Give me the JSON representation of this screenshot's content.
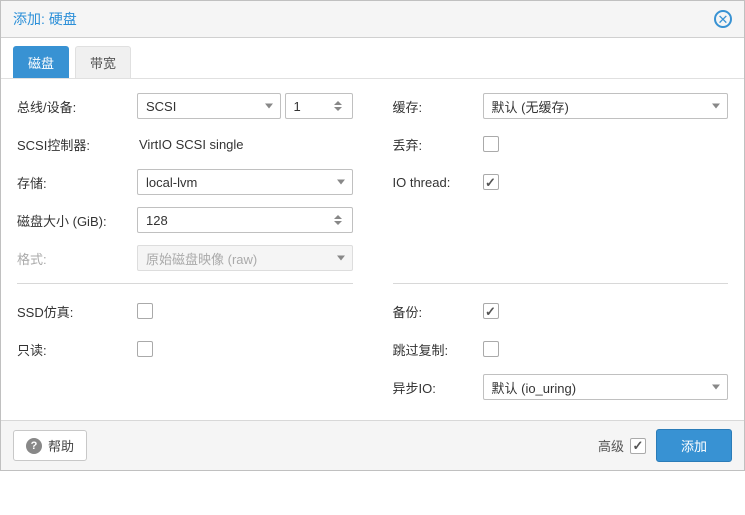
{
  "title": "添加: 硬盘",
  "tabs": {
    "disk": "磁盘",
    "bandwidth": "带宽"
  },
  "left": {
    "bus_device_label": "总线/设备:",
    "bus_value": "SCSI",
    "device_value": "1",
    "scsi_ctrl_label": "SCSI控制器:",
    "scsi_ctrl_value": "VirtIO SCSI single",
    "storage_label": "存储:",
    "storage_value": "local-lvm",
    "disk_size_label": "磁盘大小 (GiB):",
    "disk_size_value": "128",
    "format_label": "格式:",
    "format_value": "原始磁盘映像 (raw)",
    "ssd_emu_label": "SSD仿真:",
    "readonly_label": "只读:"
  },
  "right": {
    "cache_label": "缓存:",
    "cache_value": "默认 (无缓存)",
    "discard_label": "丢弃:",
    "iothread_label": "IO thread:",
    "backup_label": "备份:",
    "skip_repl_label": "跳过复制:",
    "async_io_label": "异步IO:",
    "async_io_value": "默认 (io_uring)"
  },
  "footer": {
    "help": "帮助",
    "advanced": "高级",
    "add": "添加"
  }
}
